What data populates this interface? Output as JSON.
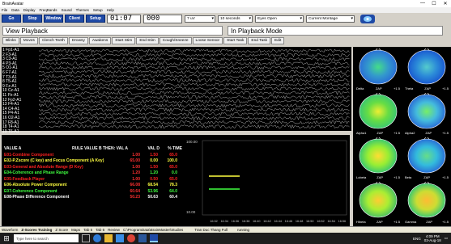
{
  "window": {
    "title": "BrainAvatar",
    "controls": [
      "—",
      "☐",
      "✕"
    ]
  },
  "menu": [
    "File",
    "Data",
    "Display",
    "FreqBands",
    "Sound",
    "Themes",
    "Setup",
    "Help"
  ],
  "toolbar": {
    "buttons": [
      "Go",
      "Stop",
      "Window",
      "Client",
      "Setup"
    ],
    "time": "01:07",
    "count": "000",
    "scale": "7 uV",
    "duration": "10 seconds",
    "state": "Eyes Open",
    "montage": "Current Montage"
  },
  "view": {
    "title": "View Playback",
    "mode": "In Playback Mode"
  },
  "actions": [
    "Blinks",
    "Moves",
    "Clench Teeth",
    "Drowsy",
    "Awakens",
    "Start Stim",
    "End Stim",
    "Cough/Sneeze",
    "Loose Sensor",
    "Start Task",
    "End Task",
    "Edit"
  ],
  "channels": [
    "1 Fp1-A1",
    "2 F3-A1",
    "3 C3-A1",
    "4 P3-A1",
    "5 O1-A1",
    "6 F7-A1",
    "7 T3-A1",
    "8 T5-A1",
    "9 Fz-A1",
    "10 Cz-A1",
    "11 Pz-A1",
    "12 Fp2-A1",
    "13 F4-A1",
    "14 C4-A1",
    "15 P4-A1",
    "16 O2-A1",
    "17 F8-A1",
    "18 T4-A1",
    "19 T6-A1"
  ],
  "table": {
    "h_name": "VALUE A",
    "h_rule": "RULE VALUE B THEN: VAL A",
    "h_vald": "VAL D",
    "h_time": "% TIME",
    "rows": [
      {
        "name": "E01-Combine Component",
        "a": "1.00",
        "b": "1.50",
        "p": "65.0",
        "color": "#ff2020"
      },
      {
        "name": "E02-P.Zscore (C key) and Focus Component (A Key)",
        "a": "65.00",
        "b": "0.00",
        "p": "100.0",
        "color": "#ffff40"
      },
      {
        "name": "E03-General and Absolute Range (D Key)",
        "a": "1.00",
        "b": "1.50",
        "p": "65.0",
        "color": "#ff2020"
      },
      {
        "name": "E04-Coherence and Phase Range",
        "a": "1.20",
        "b": "1.20",
        "p": "0.0",
        "color": "#40ff40"
      },
      {
        "name": "E05-Feedback Player",
        "a": "1.00",
        "b": "0.50",
        "p": "65.0",
        "color": "#ff2020"
      },
      {
        "name": "E06-Absolute Power Component",
        "a": "66.08",
        "b": "68.54",
        "p": "78.3",
        "color": "#ffff40"
      },
      {
        "name": "E07-Coherence Component",
        "a": "60.64",
        "b": "53.96",
        "p": "64.0",
        "color": "#40ff40"
      },
      {
        "name": "E08-Phase Difference Component",
        "a": "50.23",
        "b": "50.63",
        "p": "60.4",
        "color": "#ffffff"
      }
    ]
  },
  "plot": {
    "yticks": [
      "100.00",
      "10.00"
    ],
    "xticks": [
      "16:32",
      "16:34",
      "16:36",
      "16:38",
      "16:40",
      "16:42",
      "16:44",
      "16:46",
      "16:48",
      "16:50",
      "16:52",
      "16:54",
      "16:56"
    ]
  },
  "maps": [
    {
      "band": "Delta",
      "type": "ZAP",
      "scale": "+1.5"
    },
    {
      "band": "Theta",
      "type": "ZAP",
      "scale": "+1.5"
    },
    {
      "band": "Alpha1",
      "type": "ZAP",
      "scale": "+1.5"
    },
    {
      "band": "Alpha2",
      "type": "ZAP",
      "scale": "+1.5"
    },
    {
      "band": "Lobeta",
      "type": "ZAP",
      "scale": "+1.5"
    },
    {
      "band": "Beta",
      "type": "ZAP",
      "scale": "+1.5"
    },
    {
      "band": "Hibeta",
      "type": "ZAP",
      "scale": "+1.5"
    },
    {
      "band": "Gamma",
      "type": "ZAP",
      "scale": "+1.5"
    }
  ],
  "status": [
    "Waveform",
    "Z-Scores Training",
    "Z Score",
    "Maps",
    "Tab 5",
    "Tab 6",
    "Review",
    "C:\\ProgramData\\BrainMaster\\Studies",
    "Tran Duc Thang Full",
    "running"
  ],
  "taskbar": {
    "search": "Type here to search",
    "lang": "ENG",
    "time": "4:09 PM",
    "date": "03-Aug-18"
  }
}
